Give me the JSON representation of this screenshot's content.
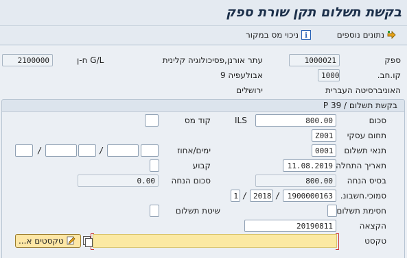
{
  "window": {
    "title": "בקשת תשלום תקן שורת ספק"
  },
  "toolbar": {
    "more_data_label": "נתונים נוספים",
    "tax_from_source_label": "ניכוי מס במקור",
    "info_icon_glyph": "i"
  },
  "header": {
    "vendor_label": "ספק",
    "vendor_value": "1000021",
    "vendor_name": "עתר אורנן,פסיכולוגיה קלינית",
    "gl_label": "ח-ן G/L",
    "gl_value": "2100000",
    "company_code_label": "קו.חב.",
    "company_code_value": "1000",
    "vendor_street": "אבולעפיה 9",
    "company_name": "האוניברסיטה העברית",
    "city": "ירושלים"
  },
  "section": {
    "title": "בקשת תשלום / P 39"
  },
  "form": {
    "amount_label": "סכום",
    "amount_value": "800.00",
    "currency": "ILS",
    "tax_code_label": "קוד מס",
    "business_area_label": "תחום עסקי",
    "business_area_value": "Z001",
    "payment_terms_label": "תנאי תשלום",
    "payment_terms_value": "0001",
    "days_percent_label": "ימים/אחוז",
    "slash": "/",
    "baseline_date_label": "תאריך התחלה",
    "baseline_date_value": "11.08.2019",
    "fixed_label": "קבוע",
    "discount_base_label": "בסיס הנחה",
    "discount_base_value": "800.00",
    "discount_amount_label": "סכום הנחה",
    "discount_amount_value": "0.00",
    "invoice_ref_label": "סמוכי.חשבונ.",
    "invoice_ref_doc": "1900000163",
    "invoice_ref_year": "2018",
    "invoice_ref_item": "1",
    "payment_block_label": "חסימת תשלום",
    "payment_method_label": "שיטת תשלום",
    "assignment_label": "הקצאה",
    "assignment_value": "20190811",
    "text_label": "טקסט",
    "texts_button_label": "טקסטים א..."
  },
  "colors": {
    "accent_yellow": "#fbe9a3",
    "title_color": "#1b2f4a",
    "background": "#ebeff4"
  }
}
